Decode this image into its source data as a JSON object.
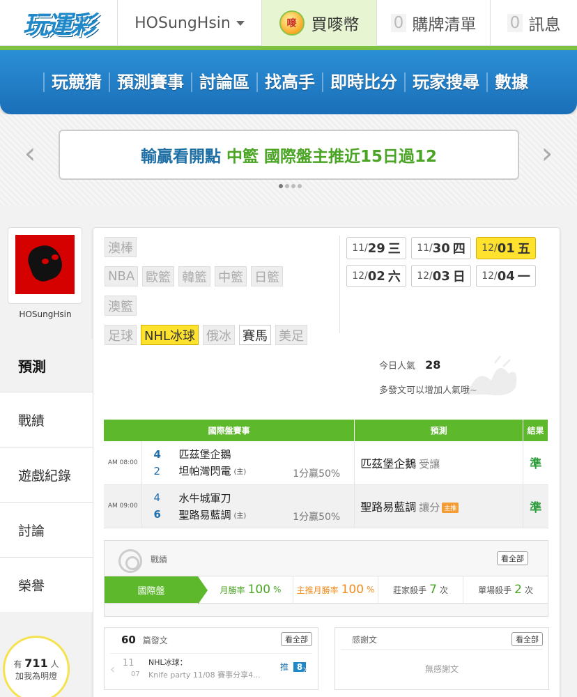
{
  "header": {
    "logo": "玩運彩",
    "username": "HOSungHsin",
    "coin_label": "買嘜幣",
    "coin_icon_text": "嘜",
    "cart_count": "0",
    "cart_label": "購牌清單",
    "msg_count": "0",
    "msg_label": "訊息"
  },
  "nav": [
    "玩競猜",
    "預測賽事",
    "討論區",
    "找高手",
    "即時比分",
    "玩家搜尋",
    "數據"
  ],
  "banner": {
    "text_main": "輸贏看開點",
    "text_highlight": "中籃 國際盤主推近15日過12",
    "prev_arrow": "‹",
    "next_arrow": "›"
  },
  "profile": {
    "username": "HOSungHsin",
    "menu": [
      "預測",
      "戰績",
      "遊戲紀錄",
      "討論",
      "榮譽"
    ],
    "fans_prefix": "有",
    "fans_count": "711",
    "fans_unit": "人",
    "fans_text": "加我為明燈"
  },
  "categories": [
    [
      {
        "label": "澳棒",
        "state": "disabled"
      }
    ],
    [
      {
        "label": "NBA",
        "state": "disabled"
      },
      {
        "label": "歐籃",
        "state": "disabled"
      },
      {
        "label": "韓籃",
        "state": "disabled"
      },
      {
        "label": "中籃",
        "state": "disabled"
      },
      {
        "label": "日籃",
        "state": "disabled"
      }
    ],
    [
      {
        "label": "澳籃",
        "state": "disabled"
      }
    ],
    [
      {
        "label": "足球",
        "state": "disabled"
      },
      {
        "label": "NHL冰球",
        "state": "active"
      },
      {
        "label": "俄冰",
        "state": "disabled"
      },
      {
        "label": "賽馬",
        "state": "enabled"
      },
      {
        "label": "美足",
        "state": "disabled"
      }
    ]
  ],
  "dates": [
    {
      "md": "11/",
      "d": "29",
      "w": "三",
      "active": false
    },
    {
      "md": "11/",
      "d": "30",
      "w": "四",
      "active": false
    },
    {
      "md": "12/",
      "d": "01",
      "w": "五",
      "active": true
    },
    {
      "md": "12/",
      "d": "02",
      "w": "六",
      "active": false
    },
    {
      "md": "12/",
      "d": "03",
      "w": "日",
      "active": false
    },
    {
      "md": "12/",
      "d": "04",
      "w": "一",
      "active": false
    }
  ],
  "popularity": {
    "label": "今日人氣",
    "value": "28",
    "hint": "多發文可以增加人氣哦~"
  },
  "prediction_table": {
    "headers": [
      "國際盤賽事",
      "預測",
      "結果"
    ],
    "rows": [
      {
        "time": "AM 08:00",
        "away_score": "4",
        "away_team": "匹茲堡企鵝",
        "home_score": "2",
        "home_team": "坦帕灣閃電",
        "home_tag": "(主)",
        "odds": "1分贏50%",
        "pick": "匹茲堡企鵝",
        "pick_sub": "受讓",
        "main_tag": "",
        "result": "準"
      },
      {
        "time": "AM 09:00",
        "away_score": "4",
        "away_team": "水牛城軍刀",
        "home_score": "6",
        "home_team": "聖路易藍調",
        "home_tag": "(主)",
        "odds": "1分贏50%",
        "pick": "聖路易藍調",
        "pick_sub": "讓分",
        "main_tag": "主推",
        "result": "準"
      }
    ]
  },
  "record": {
    "title": "戰績",
    "view_all": "看全部",
    "tab": "國際盤",
    "stats": [
      {
        "label": "月勝率",
        "value": "100",
        "unit": "%",
        "style": "green"
      },
      {
        "label": "主推月勝率",
        "value": "100",
        "unit": "%",
        "style": "orange"
      },
      {
        "label": "莊家殺手",
        "value": "7",
        "unit": "次",
        "style": "gray"
      },
      {
        "label": "單場殺手",
        "value": "2",
        "unit": "次",
        "style": "gray"
      }
    ]
  },
  "posts": {
    "count": "60",
    "label": "篇發文",
    "view_all": "看全部",
    "item": {
      "date_top": "11",
      "date_bottom": "07",
      "title": "NHL冰球：",
      "desc": "Knife party 11/08 賽事分享4...",
      "push_label": "推",
      "push_count": "8"
    }
  },
  "thanks": {
    "label": "感謝文",
    "view_all": "看全部",
    "empty": "無感謝文"
  }
}
